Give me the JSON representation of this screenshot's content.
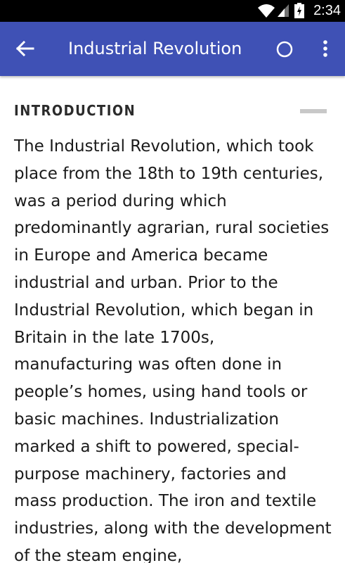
{
  "status_bar": {
    "time": "2:34",
    "icons": [
      "wifi-icon",
      "signal-icon",
      "battery-icon"
    ]
  },
  "app_bar": {
    "title": "Industrial Revolution",
    "color": "#3f51b5",
    "icons": [
      "back-arrow-icon",
      "loading-circle-icon",
      "more-vert-icon"
    ]
  },
  "section": {
    "title": "INTRODUCTION",
    "collapse_icon": "minus-icon",
    "body": "The Industrial Revolution, which took place from the 18th to 19th centuries, was a period during which predominantly agrarian, rural societies in Europe and America became industrial and urban. Prior to the Industrial Revolution, which began in Britain in the late 1700s, manufacturing was often done in people’s homes, using hand tools or basic machines. Industrialization marked a shift to powered, special-purpose machinery, factories and mass production. The iron and textile industries, along with the development of the steam engine,"
  }
}
